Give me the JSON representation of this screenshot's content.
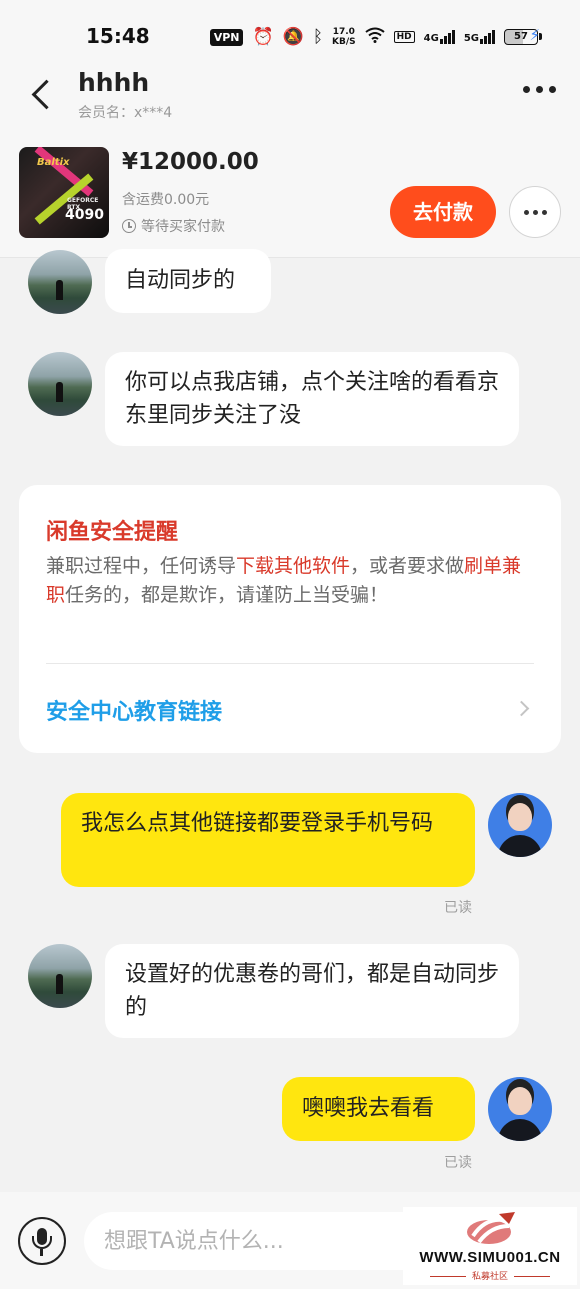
{
  "status_bar": {
    "time": "15:48",
    "vpn": "VPN",
    "speed_value": "17.0",
    "speed_unit": "KB/S",
    "hd": "HD",
    "net1": "4G",
    "net2": "5G",
    "battery": "57",
    "icons": [
      "alarm-icon",
      "mute-icon",
      "bluetooth-icon",
      "wifi-icon",
      "charging-icon"
    ]
  },
  "header": {
    "contact_name": "hhhh",
    "member_label": "会员名：x***4"
  },
  "product": {
    "thumb_brand": "Baltix",
    "thumb_model_label": "GEFORCE RTX",
    "thumb_model": "4090",
    "price": "¥12000.00",
    "shipping": "含运费0.00元",
    "status": "等待买家付款",
    "pay_label": "去付款"
  },
  "messages": [
    {
      "side": "in",
      "text": "自动同步的"
    },
    {
      "side": "in",
      "text": "你可以点我店铺，点个关注啥的看看京东里同步关注了没"
    },
    {
      "side": "out",
      "text": "我怎么点其他链接都要登录手机号码",
      "read": "已读"
    },
    {
      "side": "in",
      "text": "设置好的优惠卷的哥们，都是自动同步的"
    },
    {
      "side": "out",
      "text": "噢噢我去看看",
      "read": "已读"
    }
  ],
  "safety": {
    "title": "闲鱼安全提醒",
    "body_1": "兼职过程中，任何诱导",
    "body_hl_1": "下载其他软件",
    "body_2": "，或者要求做",
    "body_hl_2": "刷单兼职",
    "body_3": "任务的，都是欺诈，请谨防上当受骗！",
    "link": "安全中心教育链接"
  },
  "input": {
    "placeholder": "想跟TA说点什么..."
  },
  "watermark": {
    "site": "WWW.SIMU001.CN",
    "sub": "私募社区"
  },
  "colors": {
    "accent_pay": "#ff4d1c",
    "bubble_out": "#ffe60f",
    "warning_red": "#d93a2b",
    "link_blue": "#1f9ee8"
  }
}
